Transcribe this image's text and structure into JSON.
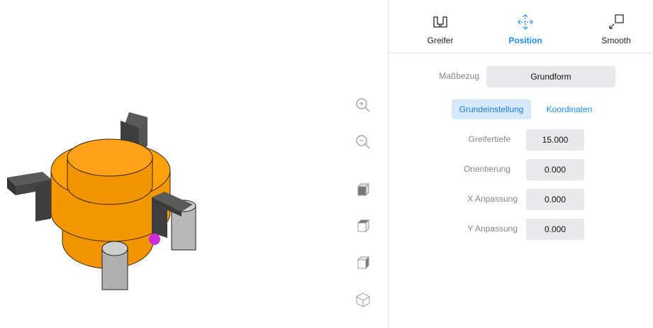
{
  "tabs": [
    {
      "label": "Greifer",
      "icon": "gripper-icon",
      "active": false
    },
    {
      "label": "Position",
      "icon": "move-arrows-icon",
      "active": true
    },
    {
      "label": "Smooth",
      "icon": "resize-corner-icon",
      "active": false
    }
  ],
  "reference": {
    "label": "Maßbezug",
    "value": "Grundform"
  },
  "subtabs": {
    "basic": "Grundeinstellung",
    "coords": "Koordinaten"
  },
  "fields": {
    "depth": {
      "label": "Greifertiefe",
      "value": "15.000"
    },
    "orientation": {
      "label": "Orientierung",
      "value": "0.000"
    },
    "x_adjust": {
      "label": "X Anpassung",
      "value": "0.000"
    },
    "y_adjust": {
      "label": "Y Anpassung",
      "value": "0.000"
    }
  },
  "tools": [
    "zoom-in-icon",
    "zoom-out-icon",
    "cube-view-front-icon",
    "cube-view-top-icon",
    "cube-view-side-icon",
    "cube-view-iso-icon"
  ],
  "colors": {
    "accent": "#1a8cff",
    "part": "#ff9f00",
    "gripper": "#4a4a4a",
    "marker": "#d02bd8"
  }
}
